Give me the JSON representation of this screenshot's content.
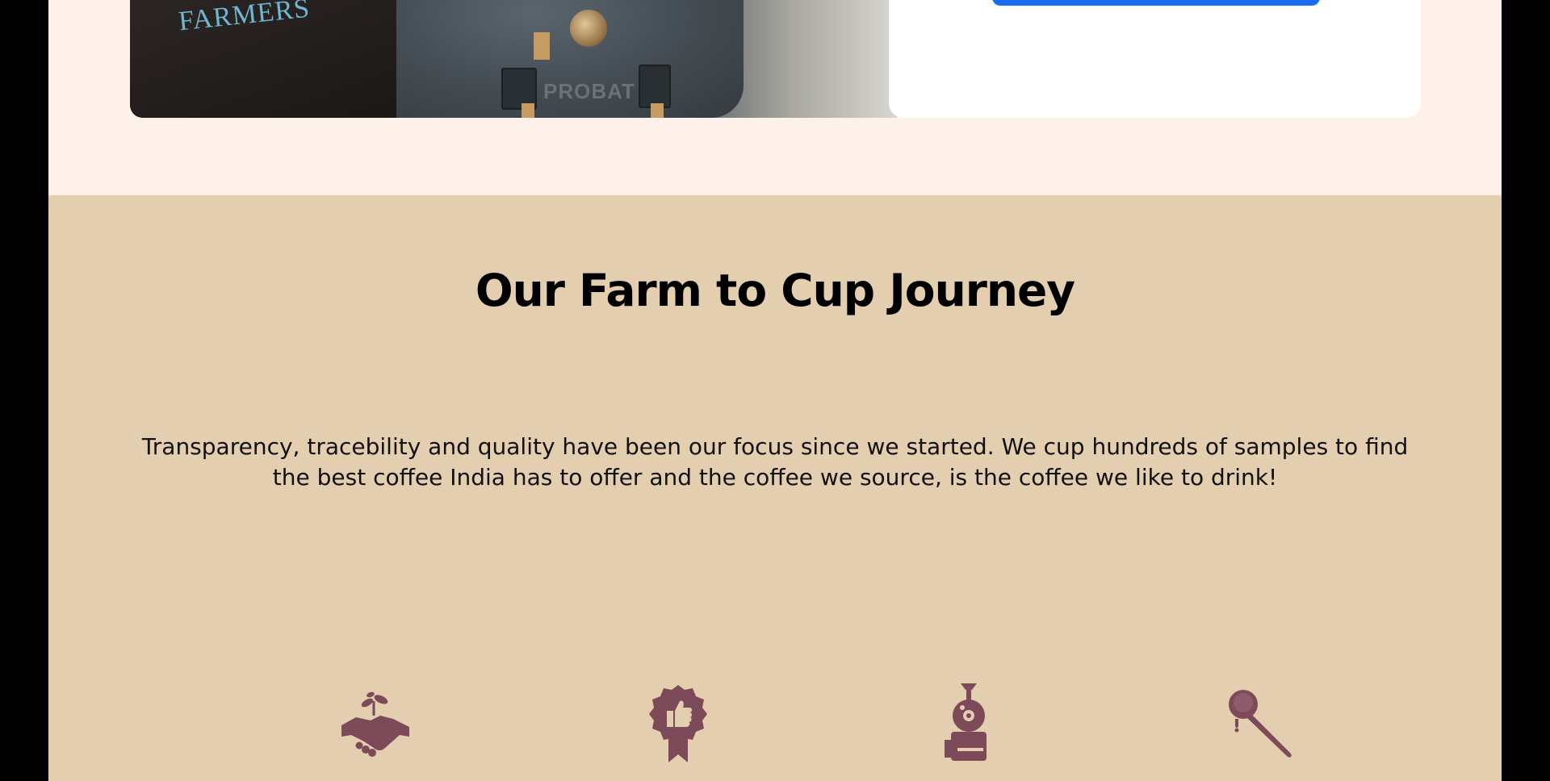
{
  "hero": {
    "shirt_text": "FARMERS",
    "roaster_label": "PROBAT"
  },
  "journey": {
    "title": "Our Farm to Cup Journey",
    "description": "Transparency, tracebility and quality have been our focus since we started. We cup hundreds of samples to find the best coffee India has to offer and the coffee we source, is the coffee we like to drink!",
    "icons": [
      {
        "name": "handshake-sprout-icon"
      },
      {
        "name": "quality-badge-icon"
      },
      {
        "name": "coffee-roaster-icon"
      },
      {
        "name": "espresso-portafilter-icon"
      }
    ],
    "icon_color": "#7d4a5a"
  },
  "colors": {
    "top_background": "#fdf1ea",
    "journey_background": "#e3ceb0",
    "button_blue": "#1a6cf0"
  }
}
